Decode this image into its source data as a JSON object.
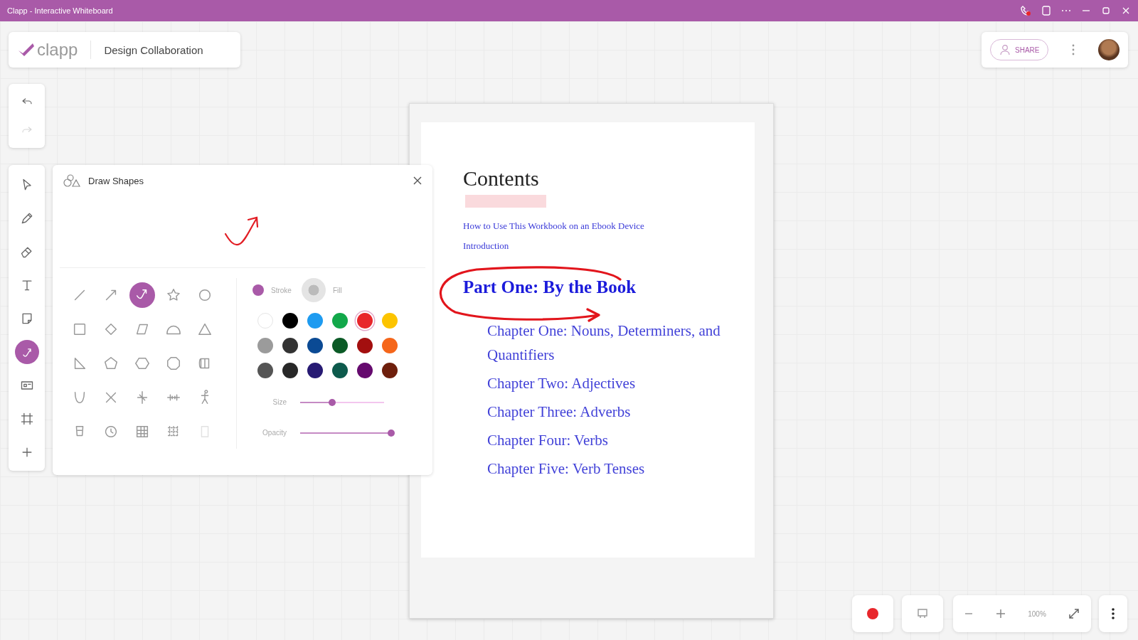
{
  "window": {
    "title": "Clapp - Interactive Whiteboard"
  },
  "header": {
    "logo": "clapp",
    "board_title": "Design Collaboration",
    "share": "SHARE"
  },
  "history": [
    {
      "kind": "undo",
      "disabled": false
    },
    {
      "kind": "redo",
      "disabled": true
    }
  ],
  "tools": [
    {
      "kind": "pointer",
      "selected": false
    },
    {
      "kind": "pen",
      "selected": false
    },
    {
      "kind": "eraser",
      "selected": false
    },
    {
      "kind": "text",
      "selected": false
    },
    {
      "kind": "note",
      "selected": false
    },
    {
      "kind": "shapes",
      "selected": true
    },
    {
      "kind": "media",
      "selected": false
    },
    {
      "kind": "frame",
      "selected": false
    },
    {
      "kind": "add",
      "selected": false
    }
  ],
  "panel": {
    "title": "Draw Shapes",
    "shapes": [
      {
        "kind": "line",
        "selected": false
      },
      {
        "kind": "arrow",
        "selected": false
      },
      {
        "kind": "ink-arrow",
        "selected": true
      },
      {
        "kind": "star",
        "selected": false
      },
      {
        "kind": "circle",
        "selected": false
      },
      {
        "kind": "square",
        "selected": false
      },
      {
        "kind": "diamond",
        "selected": false
      },
      {
        "kind": "parallelogram",
        "selected": false
      },
      {
        "kind": "dome",
        "selected": false
      },
      {
        "kind": "triangle",
        "selected": false
      },
      {
        "kind": "right-triangle",
        "selected": false
      },
      {
        "kind": "pentagon",
        "selected": false
      },
      {
        "kind": "hexagon",
        "selected": false
      },
      {
        "kind": "octagon",
        "selected": false
      },
      {
        "kind": "cylinder",
        "selected": false
      },
      {
        "kind": "cup",
        "selected": false
      },
      {
        "kind": "cross",
        "selected": false
      },
      {
        "kind": "axes",
        "selected": false
      },
      {
        "kind": "number-line",
        "selected": false
      },
      {
        "kind": "figure",
        "selected": false
      },
      {
        "kind": "beaker",
        "selected": false
      },
      {
        "kind": "clock",
        "selected": false
      },
      {
        "kind": "table",
        "selected": false
      },
      {
        "kind": "dots",
        "selected": false
      },
      {
        "kind": "blank",
        "selected": false
      }
    ],
    "modes": [
      {
        "label": "Stroke",
        "selected": true
      },
      {
        "label": "Fill",
        "selected": false
      }
    ],
    "colors": [
      {
        "color": "#ffffff",
        "selected": false
      },
      {
        "color": "#000000",
        "selected": false
      },
      {
        "color": "#1e9bf0",
        "selected": false
      },
      {
        "color": "#12a84a",
        "selected": false
      },
      {
        "color": "#e8262b",
        "selected": true
      },
      {
        "color": "#fcc400",
        "selected": false
      },
      {
        "color": "#9b9b9b",
        "selected": false
      },
      {
        "color": "#333333",
        "selected": false
      },
      {
        "color": "#0b4a94",
        "selected": false
      },
      {
        "color": "#0b5a26",
        "selected": false
      },
      {
        "color": "#a30f0f",
        "selected": false
      },
      {
        "color": "#f5661a",
        "selected": false
      },
      {
        "color": "#555555",
        "selected": false
      },
      {
        "color": "#282828",
        "selected": false
      },
      {
        "color": "#271a73",
        "selected": false
      },
      {
        "color": "#0d5a4c",
        "selected": false
      },
      {
        "color": "#650a6e",
        "selected": false
      },
      {
        "color": "#6e1f0c",
        "selected": false
      }
    ],
    "size": {
      "label": "Size",
      "level": 0.35
    },
    "opacity": {
      "label": "Opacity",
      "level": 1.0
    }
  },
  "document": {
    "heading": "Contents",
    "front_links": [
      "How to Use This Workbook on an Ebook Device",
      "Introduction"
    ],
    "part": "Part One: By the Book",
    "chapters": [
      "Chapter One: Nouns, Determiners, and Quantifiers",
      "Chapter Two: Adjectives",
      "Chapter Three: Adverbs",
      "Chapter Four: Verbs",
      "Chapter Five: Verb Tenses"
    ]
  },
  "bottom_bar": {
    "recording": true,
    "zoom": "100%"
  }
}
